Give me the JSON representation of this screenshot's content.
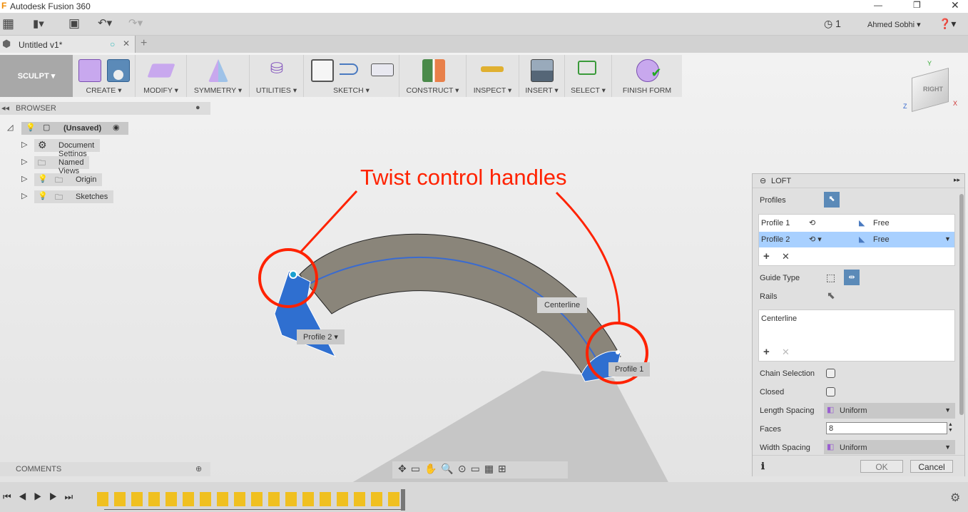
{
  "app": {
    "title": "Autodesk Fusion 360",
    "user": "Ahmed Sobhi",
    "jobs_count": "1"
  },
  "document_tab": {
    "name": "Untitled v1*"
  },
  "ribbon": {
    "workspace": "SCULPT ▾",
    "groups": [
      "CREATE ▾",
      "MODIFY ▾",
      "SYMMETRY ▾",
      "UTILITIES ▾",
      "SKETCH ▾",
      "CONSTRUCT ▾",
      "INSPECT ▾",
      "INSERT ▾",
      "SELECT ▾",
      "FINISH FORM"
    ]
  },
  "browser": {
    "title": "BROWSER",
    "root": "(Unsaved)",
    "items": [
      "Document Settings",
      "Named Views",
      "Origin",
      "Sketches"
    ]
  },
  "comments": {
    "title": "COMMENTS"
  },
  "viewcube": {
    "face": "RIGHT",
    "axes": [
      "Y",
      "Z",
      "X"
    ]
  },
  "viewport": {
    "annotation": "Twist control handles",
    "labels": {
      "centerline": "Centerline",
      "profile2": "Profile 2",
      "profile1": "Profile 1"
    },
    "annotation_color": "#ff2200",
    "profile_color": "#2f6fd0"
  },
  "loft": {
    "title": "LOFT",
    "profiles_label": "Profiles",
    "profiles": [
      {
        "name": "Profile 1",
        "condition": "Free"
      },
      {
        "name": "Profile 2",
        "condition": "Free"
      }
    ],
    "guide_type_label": "Guide Type",
    "rails_label": "Rails",
    "rails": [
      "Centerline"
    ],
    "chain_selection_label": "Chain Selection",
    "chain_selection": false,
    "closed_label": "Closed",
    "closed": false,
    "length_spacing_label": "Length Spacing",
    "length_spacing": "Uniform",
    "faces_label": "Faces",
    "faces": "8",
    "width_spacing_label": "Width Spacing",
    "width_spacing": "Uniform",
    "ok": "OK",
    "cancel": "Cancel"
  }
}
